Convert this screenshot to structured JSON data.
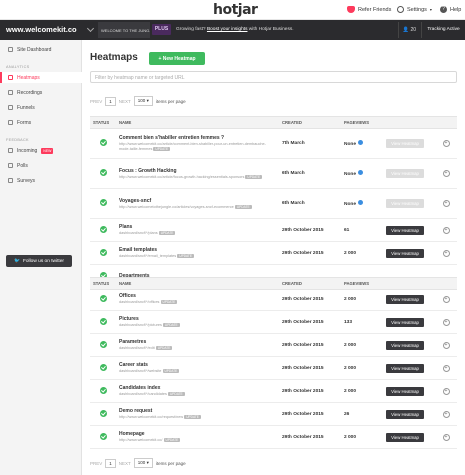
{
  "top": {
    "logo_main": "hotjar",
    "refer": "Refer Friends",
    "settings": "Settings",
    "help": "Help"
  },
  "sitebar": {
    "site": "www.welcomekit.co",
    "welcome": "WELCOME TO THE JUNG...",
    "plus": "PLUS",
    "promo_prefix": "Growing fast? ",
    "promo_link": "Boost your insights",
    "promo_suffix": " with Hotjar Business.",
    "users": "20",
    "tracking": "Tracking Active"
  },
  "sidebar": {
    "dashboard": "Site Dashboard",
    "analytics_head": "ANALYTICS",
    "heatmaps": "Heatmaps",
    "recordings": "Recordings",
    "funnels": "Funnels",
    "forms": "Forms",
    "feedback_head": "FEEDBACK",
    "incoming": "Incoming",
    "new_badge": "NEW",
    "polls": "Polls",
    "surveys": "Surveys",
    "twitter": "Follow us on twitter"
  },
  "main": {
    "title": "Heatmaps",
    "new_button": "+ New Heatmap",
    "search_placeholder": "Filter by heatmap name or targeted URL",
    "pager": {
      "prev": "PREV",
      "page": "1",
      "next": "NEXT",
      "per_page": "100",
      "per_page_label": "items per page"
    }
  },
  "table": {
    "headers": {
      "status": "STATUS",
      "name": "NAME",
      "created": "CREATED",
      "pageviews": "PAGEVIEWS"
    },
    "view_label": "View Heatmap",
    "update_label": "UPDATE",
    "rows": [
      {
        "name": "Comment bien s'habiller entretien femmes ?",
        "url": "http://www.welcomekit.co/article/comment-bien-shabiller-pour-un-entretien-dembauche-mode-taille-femmes",
        "created": "7th March",
        "pageviews": "None",
        "enabled": false
      },
      {
        "name": "Focus : Growth Hacking",
        "url": "http://www.welcomekit.co/article/focus-growth-hacking/essentials-sponsors",
        "created": "6th March",
        "pageviews": "None",
        "enabled": false
      },
      {
        "name": "Voyages-sncf",
        "url": "http://www.welcometothejungle.co/articles/voyages-sncf-ecommerce",
        "created": "6th March",
        "pageviews": "None",
        "enabled": false
      },
      {
        "name": "Plans",
        "url": "dashboard/sncf/*/plans",
        "created": "29th October 2015",
        "pageviews": "61",
        "enabled": true
      },
      {
        "name": "Email templates",
        "url": "dashboard/sncf/*/email_templates",
        "created": "29th October 2015",
        "pageviews": "2 000",
        "enabled": true
      },
      {
        "name": "Departments",
        "url": "",
        "created": "",
        "pageviews": "",
        "enabled": true
      },
      {
        "name": "Offices",
        "url": "dashboard/sncf/*/offices",
        "created": "29th October 2015",
        "pageviews": "2 000",
        "enabled": true
      },
      {
        "name": "Pictures",
        "url": "dashboard/sncf/*/pictures",
        "created": "29th October 2015",
        "pageviews": "133",
        "enabled": true
      },
      {
        "name": "Parametres",
        "url": "dashboard/sncf/*/edit",
        "created": "29th October 2015",
        "pageviews": "2 000",
        "enabled": true
      },
      {
        "name": "Career stats",
        "url": "dashboard/sncf/*/website",
        "created": "29th October 2015",
        "pageviews": "2 000",
        "enabled": true
      },
      {
        "name": "Candidates index",
        "url": "dashboard/sncf/*/candidates",
        "created": "29th October 2015",
        "pageviews": "2 000",
        "enabled": true
      },
      {
        "name": "Demo request",
        "url": "http://www.welcomekit.co/request/new",
        "created": "29th October 2015",
        "pageviews": "26",
        "enabled": true
      },
      {
        "name": "Homepage",
        "url": "http://www.welcomekit.co/",
        "created": "29th October 2015",
        "pageviews": "2 000",
        "enabled": true
      }
    ]
  }
}
